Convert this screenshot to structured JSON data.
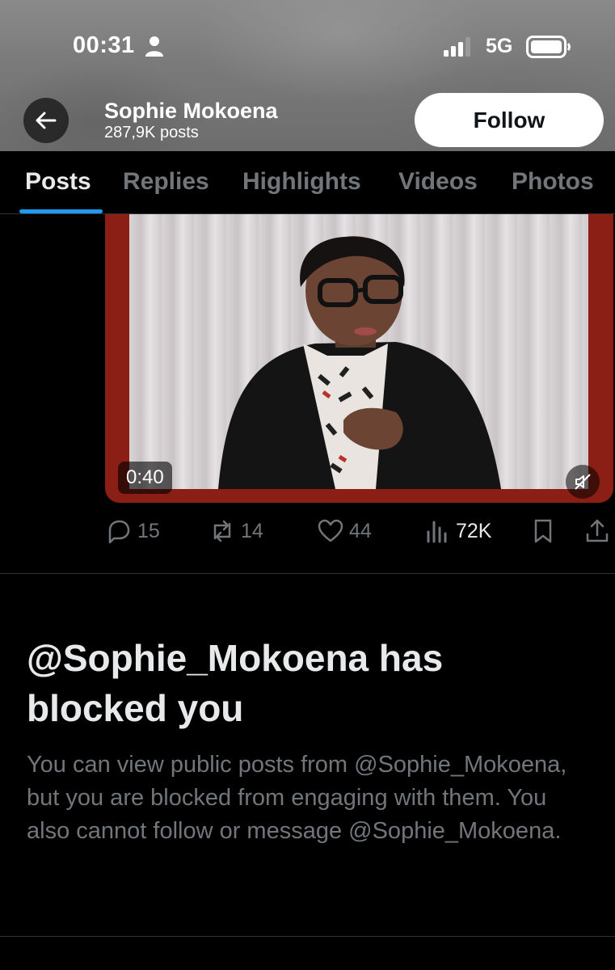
{
  "status_bar": {
    "time": "00:31",
    "network": "5G"
  },
  "profile": {
    "name": "Sophie Mokoena",
    "posts_count": "287,9K posts",
    "follow_label": "Follow"
  },
  "tabs": [
    {
      "label": "Posts",
      "active": true
    },
    {
      "label": "Replies",
      "active": false
    },
    {
      "label": "Highlights",
      "active": false
    },
    {
      "label": "Videos",
      "active": false
    },
    {
      "label": "Photos",
      "active": false
    }
  ],
  "post": {
    "video_duration": "0:40",
    "replies": "15",
    "reposts": "14",
    "likes": "44",
    "views": "72K"
  },
  "blocked": {
    "title": "@Sophie_Mokoena has blocked you",
    "description": "You can view public posts from @Sophie_Mokoena, but you are blocked from engaging with them. You also cannot follow or message @Sophie_Mokoena."
  },
  "colors": {
    "accent": "#1d9bf0",
    "background": "#000000",
    "muted_text": "#71767b",
    "primary_text": "#e7e9ea"
  }
}
